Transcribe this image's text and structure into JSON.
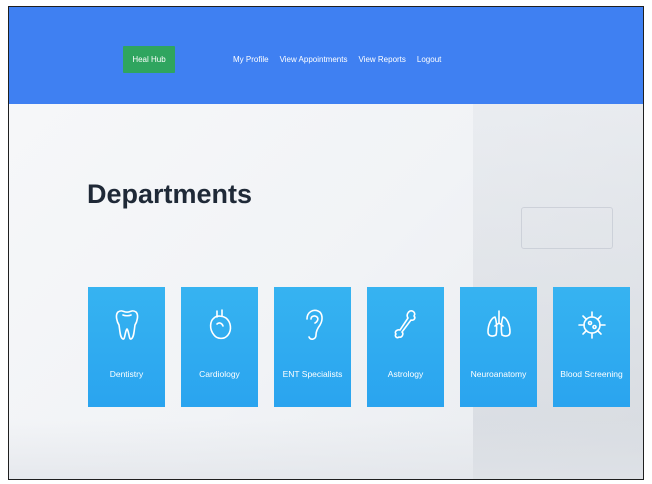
{
  "header": {
    "brand": "Heal Hub",
    "nav": [
      {
        "label": "My Profile"
      },
      {
        "label": "View Appointments"
      },
      {
        "label": "View Reports"
      },
      {
        "label": "Logout"
      }
    ],
    "colors": {
      "navbar": "#3f80f2",
      "brand": "#2fa55f"
    }
  },
  "main": {
    "title": "Departments",
    "departments": [
      {
        "label": "Dentistry",
        "icon": "tooth-icon"
      },
      {
        "label": "Cardiology",
        "icon": "heart-icon"
      },
      {
        "label": "ENT Specialists",
        "icon": "ear-icon"
      },
      {
        "label": "Astrology",
        "icon": "bone-icon"
      },
      {
        "label": "Neuroanatomy",
        "icon": "lungs-icon"
      },
      {
        "label": "Blood Screening",
        "icon": "virus-icon"
      }
    ],
    "card_color": "#2ea8f0"
  }
}
